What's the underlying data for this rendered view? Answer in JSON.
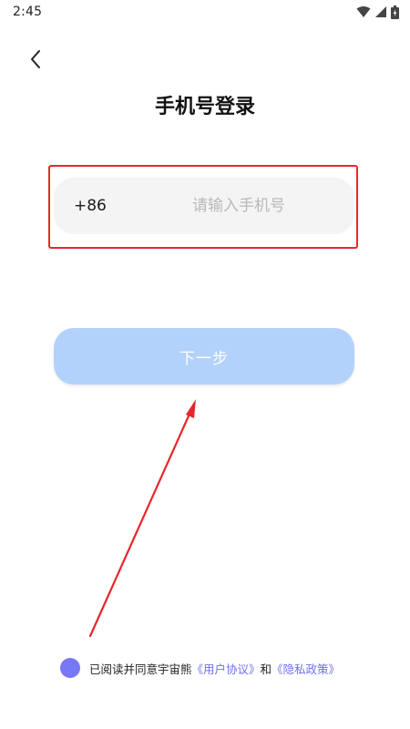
{
  "status_bar": {
    "time": "2:45",
    "icons": [
      "wifi-icon",
      "cellular-signal-icon",
      "battery-charging-icon"
    ]
  },
  "header": {
    "back_icon": "chevron-left-icon",
    "title": "手机号登录"
  },
  "phone_field": {
    "country_code": "+86",
    "value": "",
    "placeholder": "请输入手机号"
  },
  "next_button": {
    "label": "下一步"
  },
  "agreement": {
    "prefix": "已阅读并同意宇宙熊",
    "user_agreement": "《用户协议》",
    "conjunction": "和",
    "privacy_policy": "《隐私政策》"
  },
  "colors": {
    "highlight_border": "#e8262c",
    "annotation_arrow": "#e8262c",
    "button_disabled": "#b3d2fb",
    "field_background": "#f4f4f4",
    "link": "#6f6ff0",
    "checkbox": "#7878f5"
  }
}
